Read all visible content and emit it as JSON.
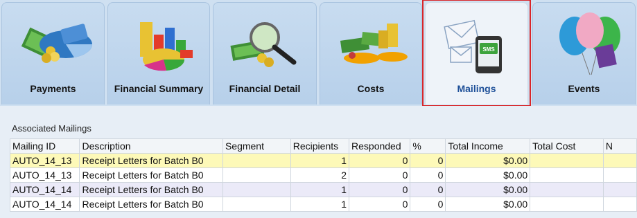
{
  "tabs": [
    {
      "label": "Payments",
      "icon": "payments-icon"
    },
    {
      "label": "Financial Summary",
      "icon": "financial-summary-icon"
    },
    {
      "label": "Financial Detail",
      "icon": "financial-detail-icon"
    },
    {
      "label": "Costs",
      "icon": "costs-icon"
    },
    {
      "label": "Mailings",
      "icon": "mailings-icon",
      "active": true,
      "sms_text": "SMS"
    },
    {
      "label": "Events",
      "icon": "events-icon"
    }
  ],
  "section": {
    "title": "Associated Mailings"
  },
  "table": {
    "columns": [
      "Mailing ID",
      "Description",
      "Segment",
      "Recipients",
      "Responded",
      "%",
      "Total Income",
      "Total Cost",
      "N"
    ],
    "rows": [
      [
        "AUTO_14_13",
        "Receipt Letters for Batch B0",
        "",
        "1",
        "0",
        "0",
        "$0.00",
        "",
        ""
      ],
      [
        "AUTO_14_13",
        "Receipt Letters for Batch B0",
        "",
        "2",
        "0",
        "0",
        "$0.00",
        "",
        ""
      ],
      [
        "AUTO_14_14",
        "Receipt Letters for Batch B0",
        "",
        "1",
        "0",
        "0",
        "$0.00",
        "",
        ""
      ],
      [
        "AUTO_14_14",
        "Receipt Letters for Batch B0",
        "",
        "1",
        "0",
        "0",
        "$0.00",
        "",
        ""
      ]
    ]
  },
  "colors": {
    "active_tab_text": "#1d4f98",
    "highlight_border": "#d9262a",
    "selected_row": "#fdf9b8"
  }
}
